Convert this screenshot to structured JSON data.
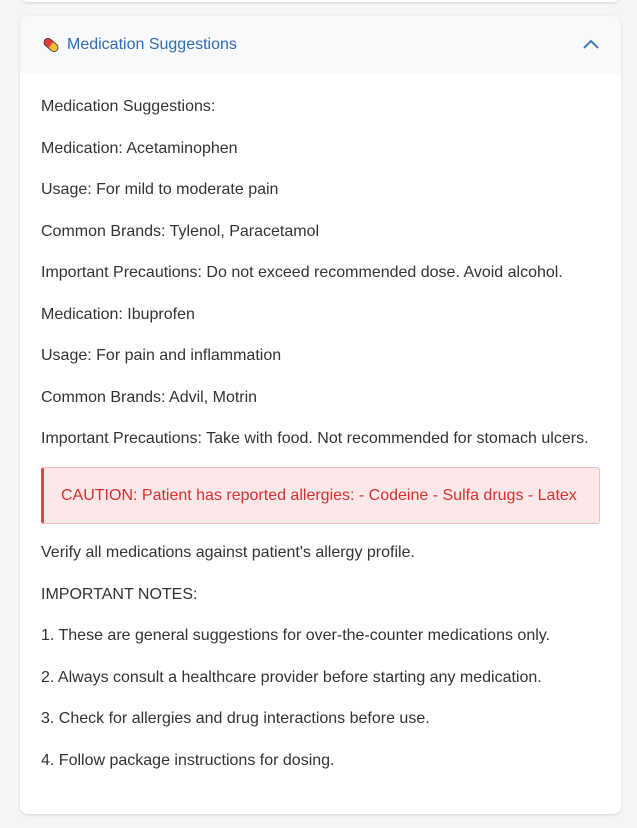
{
  "panel": {
    "title": "Medication Suggestions",
    "header_icon": "pill-icon",
    "toggle_icon": "chevron-up-icon"
  },
  "content": {
    "intro": "Medication Suggestions:",
    "medications": [
      {
        "name": "Medication: Acetaminophen",
        "usage": "Usage: For mild to moderate pain",
        "brands": "Common Brands: Tylenol, Paracetamol",
        "precautions": "Important Precautions: Do not exceed recommended dose. Avoid alcohol."
      },
      {
        "name": "Medication: Ibuprofen",
        "usage": "Usage: For pain and inflammation",
        "brands": "Common Brands: Advil, Motrin",
        "precautions": "Important Precautions: Take with food. Not recommended for stomach ulcers."
      }
    ],
    "caution": "CAUTION: Patient has reported allergies: - Codeine - Sulfa drugs - Latex",
    "verify": "Verify all medications against patient's allergy profile.",
    "notes_title": "IMPORTANT NOTES:",
    "notes": [
      "1. These are general suggestions for over-the-counter medications only.",
      "2. Always consult a healthcare provider before starting any medication.",
      "3. Check for allergies and drug interactions before use.",
      "4. Follow package instructions for dosing."
    ]
  },
  "colors": {
    "accent": "#2f6db5",
    "caution_text": "#d83030",
    "caution_bg": "#fce8e8",
    "caution_border": "#e04848"
  }
}
